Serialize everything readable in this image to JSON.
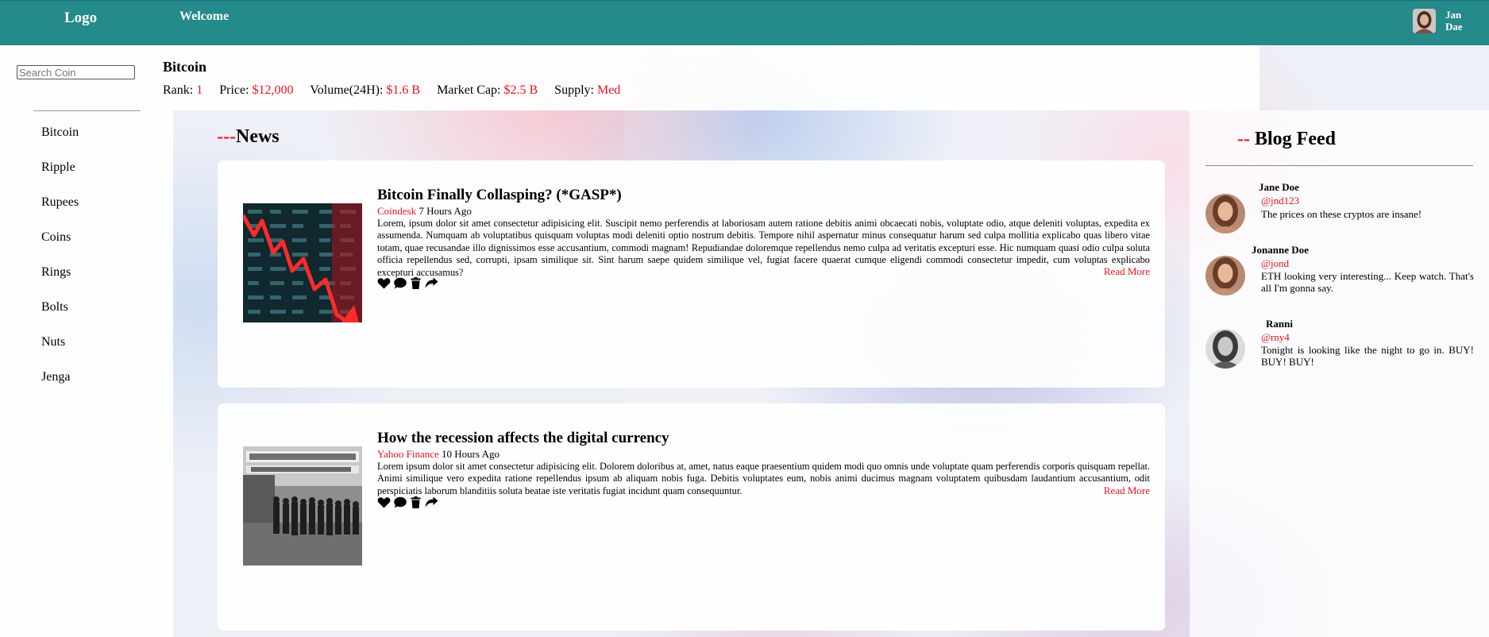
{
  "header": {
    "logo": "Logo",
    "welcome": "Welcome",
    "user_name": "Jan Dae"
  },
  "sidebar": {
    "search_placeholder": "Search Coin",
    "items": [
      {
        "label": "Bitcoin"
      },
      {
        "label": "Ripple"
      },
      {
        "label": "Rupees"
      },
      {
        "label": "Coins"
      },
      {
        "label": "Rings"
      },
      {
        "label": "Bolts"
      },
      {
        "label": "Nuts"
      },
      {
        "label": "Jenga"
      }
    ]
  },
  "coin": {
    "name": "Bitcoin",
    "stats": [
      {
        "label": "Rank:",
        "value": "1"
      },
      {
        "label": "Price:",
        "value": "$12,000"
      },
      {
        "label": "Volume(24H):",
        "value": "$1.6 B"
      },
      {
        "label": "Market Cap:",
        "value": "$2.5 B"
      },
      {
        "label": "Supply:",
        "value": "Med"
      }
    ]
  },
  "news": {
    "heading_prefix": "---",
    "heading": "News",
    "articles": [
      {
        "title": "Bitcoin Finally Collasping? (*GASP*)",
        "source": "Coindesk",
        "time": "7 Hours Ago",
        "body": "Lorem, ipsum dolor sit amet consectetur adipisicing elit. Suscipit nemo perferendis at laboriosam autem ratione debitis animi obcaecati nobis, voluptate odio, atque deleniti voluptas, expedita ex assumenda. Numquam ab voluptatibus quisquam voluptas modi deleniti optio nostrum debitis. Tempore nihil aspernatur minus consequatur harum sed culpa mollitia explicabo quas libero vitae totam, quae recusandae illo dignissimos esse accusantium, commodi magnam! Repudiandae doloremque repellendus nemo culpa ad veritatis excepturi esse. Hic numquam quasi odio culpa soluta officia repellendus sed, corrupti, ipsam similique sit. Sint harum saepe quidem similique vel, fugiat facere quaerat cumque eligendi commodi consectetur impedit, cum voluptas explicabo excepturi accusamus?",
        "read_more": "Read More"
      },
      {
        "title": "How the recession affects the digital currency",
        "source": "Yahoo Finance",
        "time": "10 Hours Ago",
        "body": "Lorem ipsum dolor sit amet consectetur adipisicing elit. Dolorem doloribus at, amet, natus eaque praesentium quidem modi quo omnis unde voluptate quam perferendis corporis quisquam repellat. Animi similique vero expedita ratione repellendus ipsum ab aliquam nobis fuga. Debitis voluptates eum, nobis animi ducimus magnam voluptatem quibusdam laudantium accusantium, odit perspiciatis laborum blanditiis soluta beatae iste veritatis fugiat incidunt quam consequuntur.",
        "read_more": "Read More"
      }
    ],
    "action_icons": [
      "heart-icon",
      "comment-icon",
      "trash-icon",
      "share-icon"
    ]
  },
  "blog": {
    "heading_prefix": "--",
    "heading": "Blog Feed",
    "posts": [
      {
        "name": "Jane Doe",
        "handle": "@jnd123",
        "text": "The prices on these cryptos are insane!"
      },
      {
        "name": "Jonanne Doe",
        "handle": "@jond",
        "text": "ETH looking very interesting... Keep watch. That's all I'm gonna say."
      },
      {
        "name": "Ranni",
        "handle": "@rny4",
        "text": "Tonight is looking like the night to go in. BUY! BUY! BUY!"
      }
    ]
  },
  "colors": {
    "header": "#248a8a",
    "accent_red": "#e8141d"
  }
}
